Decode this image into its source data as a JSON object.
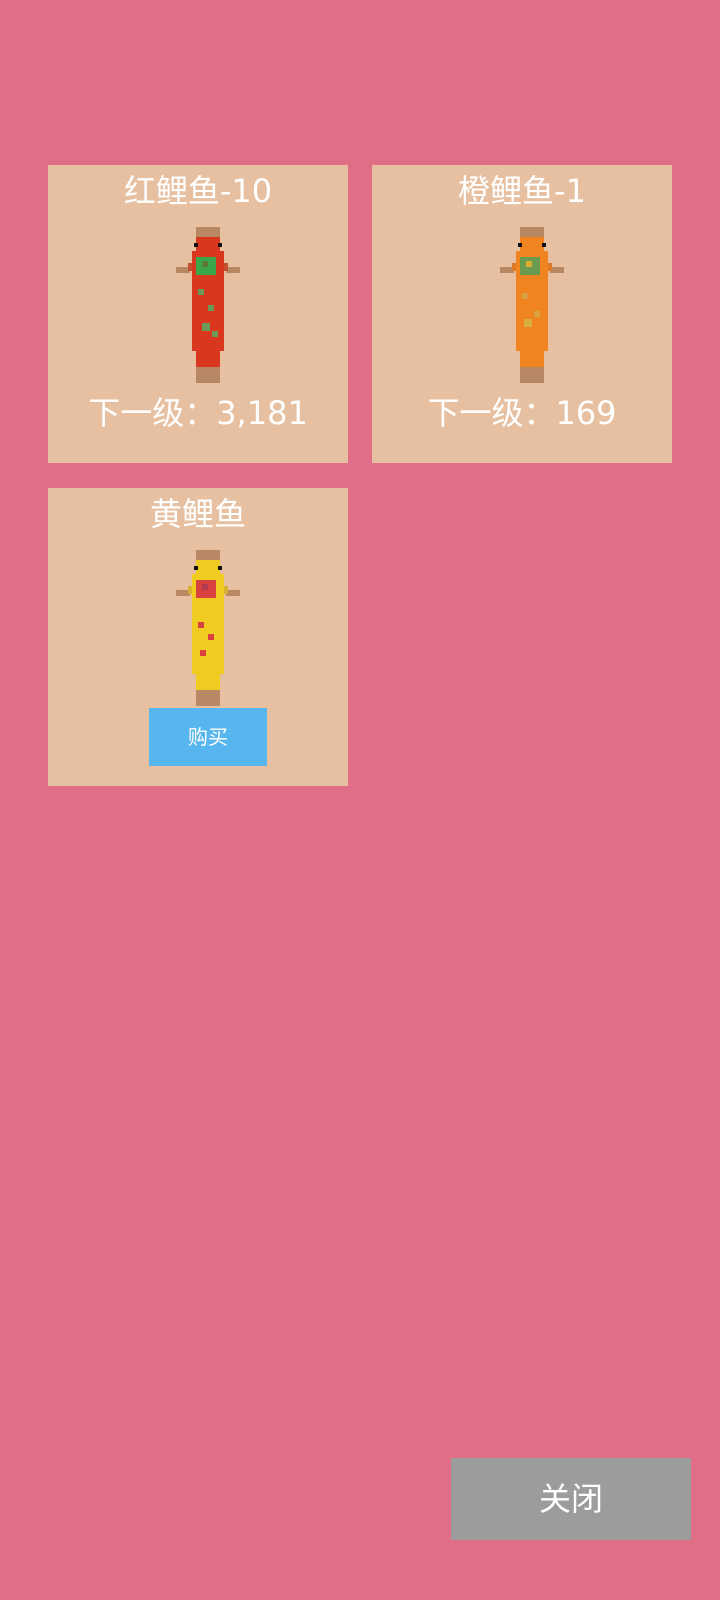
{
  "fish_cards": [
    {
      "title": "红鲤鱼-10",
      "next_level": "下一级：3,181",
      "body_color": "#d9381e",
      "mark_color": "#6a9a5a",
      "head_mark_color": "#3aa84a"
    },
    {
      "title": "橙鲤鱼-1",
      "next_level": "下一级：169",
      "body_color": "#f0841e",
      "mark_color": "#d9a040",
      "head_mark_color": "#5a9a50"
    },
    {
      "title": "黄鲤鱼",
      "buy_label": "购买",
      "body_color": "#f0cc20",
      "mark_color": "#d94040",
      "head_mark_color": "#d94040"
    }
  ],
  "close_label": "关闭"
}
